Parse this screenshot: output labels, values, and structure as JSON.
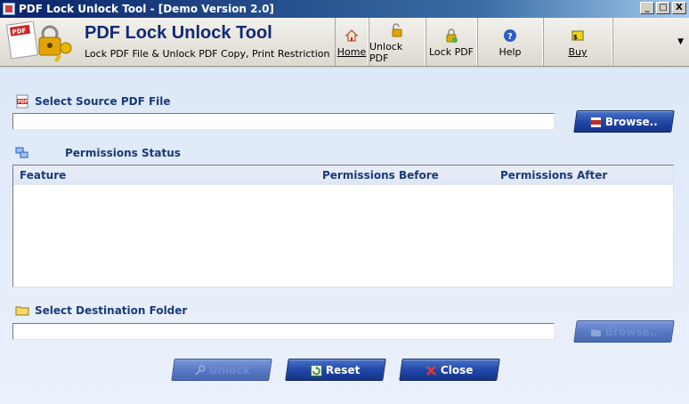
{
  "window": {
    "title": "PDF Lock Unlock Tool - [Demo Version 2.0]",
    "controls": [
      "_",
      "□",
      "X"
    ]
  },
  "header": {
    "app_title": "PDF Lock Unlock Tool",
    "subtitle": "Lock PDF File & Unlock PDF Copy, Print Restriction",
    "toolbar": [
      {
        "label": "Home",
        "icon": "home-icon"
      },
      {
        "label": "Unlock PDF",
        "icon": "unlock-icon"
      },
      {
        "label": "Lock PDF",
        "icon": "lock-icon"
      },
      {
        "label": "Help",
        "icon": "help-icon"
      },
      {
        "label": "Buy",
        "icon": "buy-icon"
      }
    ],
    "dropdown_glyph": "▼"
  },
  "source": {
    "label": "Select Source PDF File",
    "value": "",
    "browse_label": "Browse.."
  },
  "permissions": {
    "label": "Permissions Status",
    "columns": [
      "Feature",
      "Permissions Before",
      "Permissions After"
    ],
    "rows": []
  },
  "destination": {
    "label": "Select Destination Folder",
    "value": "",
    "browse_label": "Browse.."
  },
  "actions": {
    "unlock_label": "Unlock",
    "reset_label": "Reset",
    "close_label": "Close"
  },
  "colors": {
    "accent": "#1f45a6",
    "label_text": "#1a3a7a",
    "title_text": "#10287a"
  }
}
